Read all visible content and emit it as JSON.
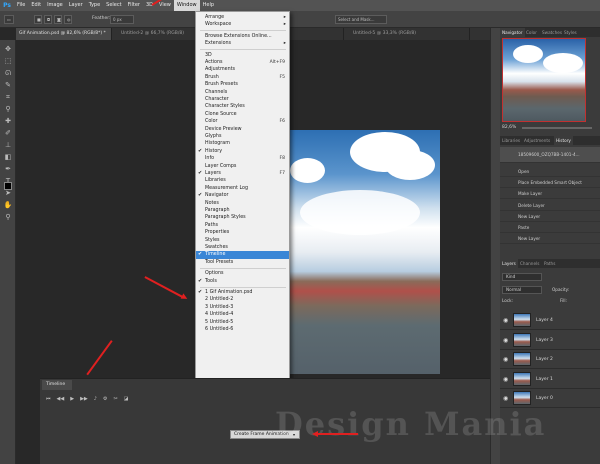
{
  "app": {
    "logo": "Ps"
  },
  "menubar": [
    "File",
    "Edit",
    "Image",
    "Layer",
    "Type",
    "Select",
    "Filter",
    "3D",
    "View",
    "Window",
    "Help"
  ],
  "options_bar": {
    "feather_label": "Feather:",
    "feather_value": "0 px",
    "select_mask": "Select and Mask..."
  },
  "tabs": [
    {
      "label": "Gif Animation.psd @ 82,6% (RGB/8*) *",
      "active": true
    },
    {
      "label": "Untitled-2 @ 66,7% (RGB/8)",
      "active": false
    },
    {
      "label": "Untitled-4 @ 33,3% (RGB/8)",
      "active": false
    },
    {
      "label": "Untitled-5 @ 33,3% (RGB/8)",
      "active": false
    }
  ],
  "window_menu": {
    "groups": [
      [
        {
          "label": "Arrange",
          "submenu": true
        },
        {
          "label": "Workspace",
          "submenu": true
        }
      ],
      [
        {
          "label": "Browse Extensions Online..."
        },
        {
          "label": "Extensions",
          "submenu": true
        }
      ],
      [
        {
          "label": "3D"
        },
        {
          "label": "Actions",
          "shortcut": "Alt+F9"
        },
        {
          "label": "Adjustments"
        },
        {
          "label": "Brush",
          "shortcut": "F5"
        },
        {
          "label": "Brush Presets"
        },
        {
          "label": "Channels"
        },
        {
          "label": "Character"
        },
        {
          "label": "Character Styles"
        },
        {
          "label": "Clone Source"
        },
        {
          "label": "Color",
          "shortcut": "F6"
        },
        {
          "label": "Device Preview"
        },
        {
          "label": "Glyphs"
        },
        {
          "label": "Histogram"
        },
        {
          "label": "History",
          "checked": true
        },
        {
          "label": "Info",
          "shortcut": "F8"
        },
        {
          "label": "Layer Comps"
        },
        {
          "label": "Layers",
          "checked": true,
          "shortcut": "F7"
        },
        {
          "label": "Libraries"
        },
        {
          "label": "Measurement Log"
        },
        {
          "label": "Navigator",
          "checked": true
        },
        {
          "label": "Notes"
        },
        {
          "label": "Paragraph"
        },
        {
          "label": "Paragraph Styles"
        },
        {
          "label": "Paths"
        },
        {
          "label": "Properties"
        },
        {
          "label": "Styles"
        },
        {
          "label": "Swatches"
        },
        {
          "label": "Timeline",
          "checked": true,
          "highlighted": true
        },
        {
          "label": "Tool Presets"
        }
      ],
      [
        {
          "label": "Options"
        },
        {
          "label": "Tools",
          "checked": true
        }
      ],
      [
        {
          "label": "1 Gif Animation.psd",
          "checked": true
        },
        {
          "label": "2 Untitled-2"
        },
        {
          "label": "3 Untitled-3"
        },
        {
          "label": "4 Untitled-4"
        },
        {
          "label": "5 Untitled-5"
        },
        {
          "label": "6 Untitled-6"
        }
      ]
    ]
  },
  "navigator": {
    "tabs": [
      "Navigator",
      "Color",
      "Swatches",
      "Styles"
    ],
    "zoom": "82,6%"
  },
  "history": {
    "tabs": [
      "Libraries",
      "Adjustments",
      "History"
    ],
    "snapshot": "18509600_OZQ7BB-1401-4...",
    "items": [
      "Open",
      "Place Embedded Smart Object",
      "Make Layer",
      "Delete Layer",
      "New Layer",
      "Paste",
      "New Layer"
    ]
  },
  "layers": {
    "tabs": [
      "Layers",
      "Channels",
      "Paths"
    ],
    "kind_label": "Kind",
    "blend_mode": "Normal",
    "opacity_label": "Opacity:",
    "lock_label": "Lock:",
    "fill_label": "Fill:",
    "items": [
      "Layer 4",
      "Layer 3",
      "Layer 2",
      "Layer 1",
      "Layer 0"
    ]
  },
  "timeline": {
    "tab_label": "Timeline",
    "create_button": "Create Frame Animation"
  },
  "watermark": "Design Mania",
  "colors": {
    "accent": "#3a86d6",
    "arrow": "#e02020",
    "ps_blue": "#31a8ff"
  }
}
